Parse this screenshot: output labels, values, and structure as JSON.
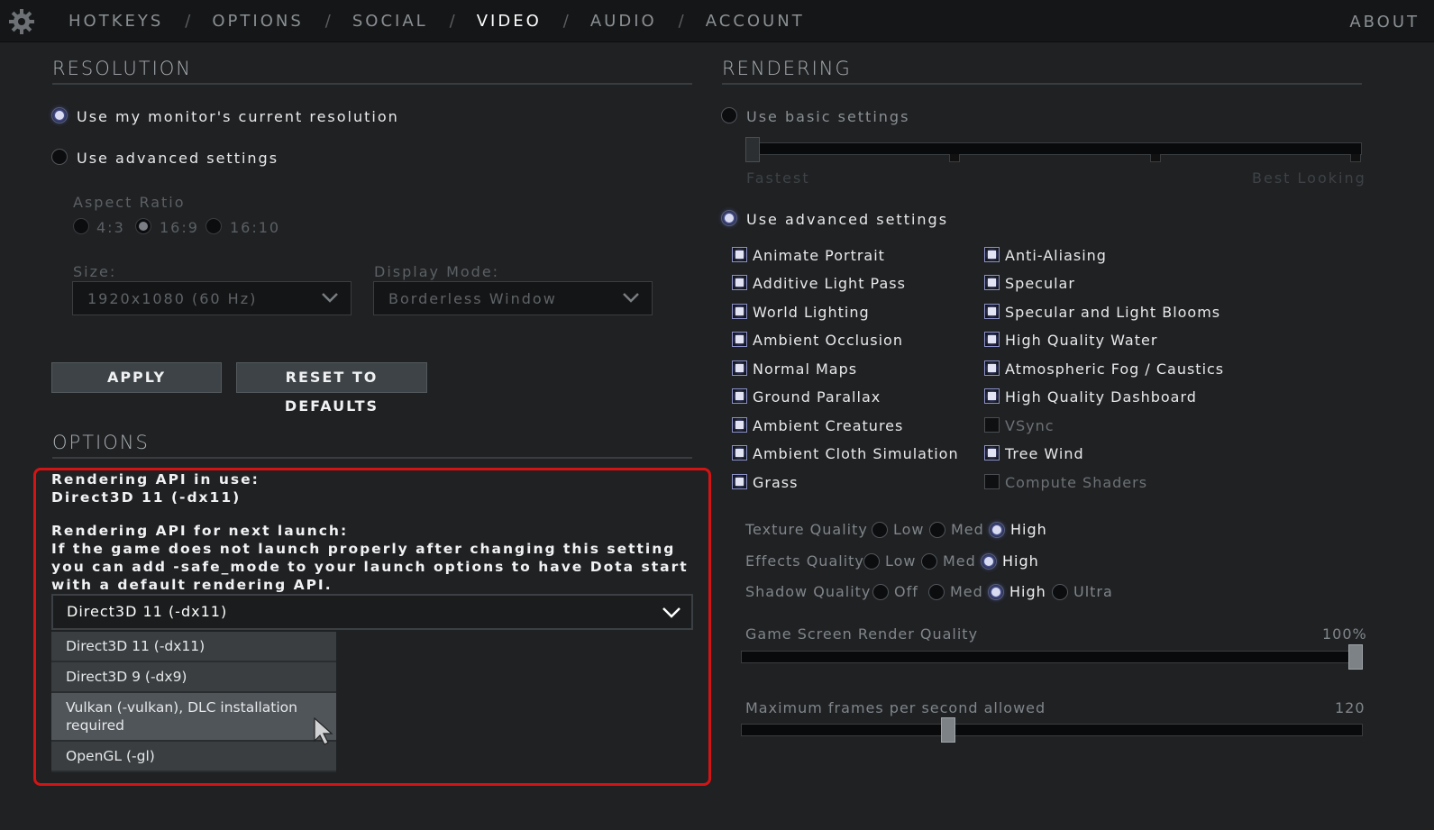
{
  "nav": {
    "tabs": [
      {
        "label": "HOTKEYS"
      },
      {
        "label": "OPTIONS"
      },
      {
        "label": "SOCIAL"
      },
      {
        "label": "VIDEO",
        "active": true
      },
      {
        "label": "AUDIO"
      },
      {
        "label": "ACCOUNT"
      }
    ],
    "separator": "/",
    "about": "ABOUT"
  },
  "resolution": {
    "title": "RESOLUTION",
    "use_current": "Use my monitor's current resolution",
    "use_advanced": "Use advanced settings",
    "selected": "use_current",
    "aspect_ratio_label": "Aspect Ratio",
    "aspect_options": [
      "4:3",
      "16:9",
      "16:10"
    ],
    "aspect_selected": "16:9",
    "size_label": "Size:",
    "size_value": "1920x1080 (60 Hz)",
    "display_mode_label": "Display Mode:",
    "display_mode_value": "Borderless Window",
    "apply_label": "APPLY",
    "reset_label": "RESET TO DEFAULTS"
  },
  "options": {
    "title": "OPTIONS",
    "api_in_use_label": "Rendering API in use:",
    "api_in_use_value": "Direct3D 11 (-dx11)",
    "api_next_label": "Rendering API for next launch:",
    "api_note": "If the game does not launch properly after changing this setting you can add -safe_mode to your launch options to have Dota start with a default rendering API.",
    "api_selected": "Direct3D 11 (-dx11)",
    "api_options": [
      "Direct3D 11 (-dx11)",
      "Direct3D 9 (-dx9)",
      "Vulkan (-vulkan), DLC installation required",
      "OpenGL (-gl)"
    ],
    "api_hovered": "Vulkan (-vulkan), DLC installation required"
  },
  "rendering": {
    "title": "RENDERING",
    "use_basic": "Use basic settings",
    "basic_slider_min": "Fastest",
    "basic_slider_max": "Best Looking",
    "use_advanced": "Use advanced settings",
    "selected": "use_advanced",
    "checks_left": [
      {
        "label": "Animate Portrait",
        "checked": true
      },
      {
        "label": "Additive Light Pass",
        "checked": true
      },
      {
        "label": "World Lighting",
        "checked": true
      },
      {
        "label": "Ambient Occlusion",
        "checked": true
      },
      {
        "label": "Normal Maps",
        "checked": true
      },
      {
        "label": "Ground Parallax",
        "checked": true
      },
      {
        "label": "Ambient Creatures",
        "checked": true
      },
      {
        "label": "Ambient Cloth Simulation",
        "checked": true
      },
      {
        "label": "Grass",
        "checked": true
      }
    ],
    "checks_right": [
      {
        "label": "Anti-Aliasing",
        "checked": true
      },
      {
        "label": "Specular",
        "checked": true
      },
      {
        "label": "Specular and Light Blooms",
        "checked": true
      },
      {
        "label": "High Quality Water",
        "checked": true
      },
      {
        "label": "Atmospheric Fog / Caustics",
        "checked": true
      },
      {
        "label": "High Quality Dashboard",
        "checked": true
      },
      {
        "label": "VSync",
        "checked": false
      },
      {
        "label": "Tree Wind",
        "checked": true
      },
      {
        "label": "Compute Shaders",
        "checked": false
      }
    ],
    "texture_quality": {
      "label": "Texture Quality",
      "options": [
        "Low",
        "Med",
        "High"
      ],
      "selected": "High"
    },
    "effects_quality": {
      "label": "Effects Quality",
      "options": [
        "Low",
        "Med",
        "High"
      ],
      "selected": "High"
    },
    "shadow_quality": {
      "label": "Shadow Quality",
      "options": [
        "Off",
        "Med",
        "High",
        "Ultra"
      ],
      "selected": "High"
    },
    "render_quality_label": "Game Screen Render Quality",
    "render_quality_value": "100%",
    "render_quality_fraction": 1.0,
    "max_fps_label": "Maximum frames per second allowed",
    "max_fps_value": "120",
    "max_fps_fraction": 0.33
  },
  "colors": {
    "accent": "#6b78d8",
    "highlight_box": "#d41414"
  },
  "icons": {
    "settings": "gear-icon",
    "dropdown": "chevron-down-icon",
    "pointer": "mouse-cursor-icon"
  }
}
